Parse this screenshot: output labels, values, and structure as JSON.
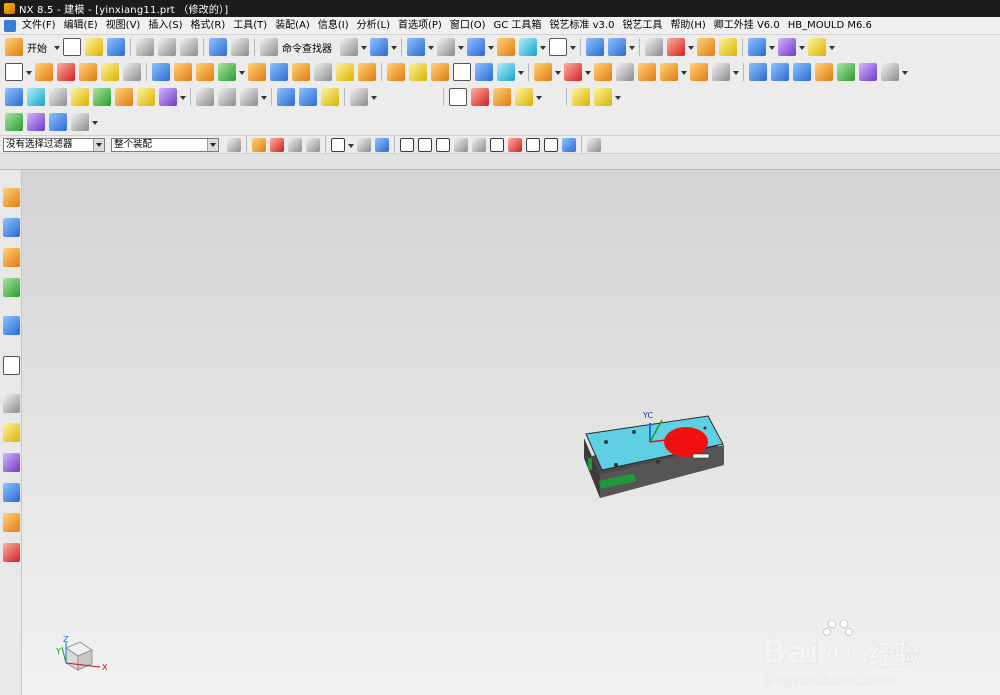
{
  "window": {
    "title": "NX 8.5 - 建模 - [yinxiang11.prt （修改的）]"
  },
  "menu": {
    "items": [
      "文件(F)",
      "编辑(E)",
      "视图(V)",
      "插入(S)",
      "格式(R)",
      "工具(T)",
      "装配(A)",
      "信息(I)",
      "分析(L)",
      "首选项(P)",
      "窗口(O)",
      "GC 工具箱",
      "锐艺标准 v3.0",
      "锐艺工具",
      "帮助(H)",
      "卿工外挂 V6.0",
      "HB_MOULD M6.6"
    ]
  },
  "toolbar": {
    "start_label": "开始",
    "command_finder_label": "命令查找器"
  },
  "selection": {
    "filter_value": "没有选择过滤器",
    "scope_value": "整个装配"
  },
  "viewport": {
    "wcs_label": "YC",
    "triad_x": "X",
    "triad_y": "Y",
    "triad_z": "Z",
    "part_colors": {
      "top": "#5fd0e4",
      "body": "#4a4a4a",
      "circle": "#f01010",
      "accent": "#1f9a3a"
    }
  },
  "watermark": {
    "brand": "Bai",
    "brand_paw": "du",
    "brand_cn": "经验",
    "url": "jingyan.baidu.com"
  }
}
